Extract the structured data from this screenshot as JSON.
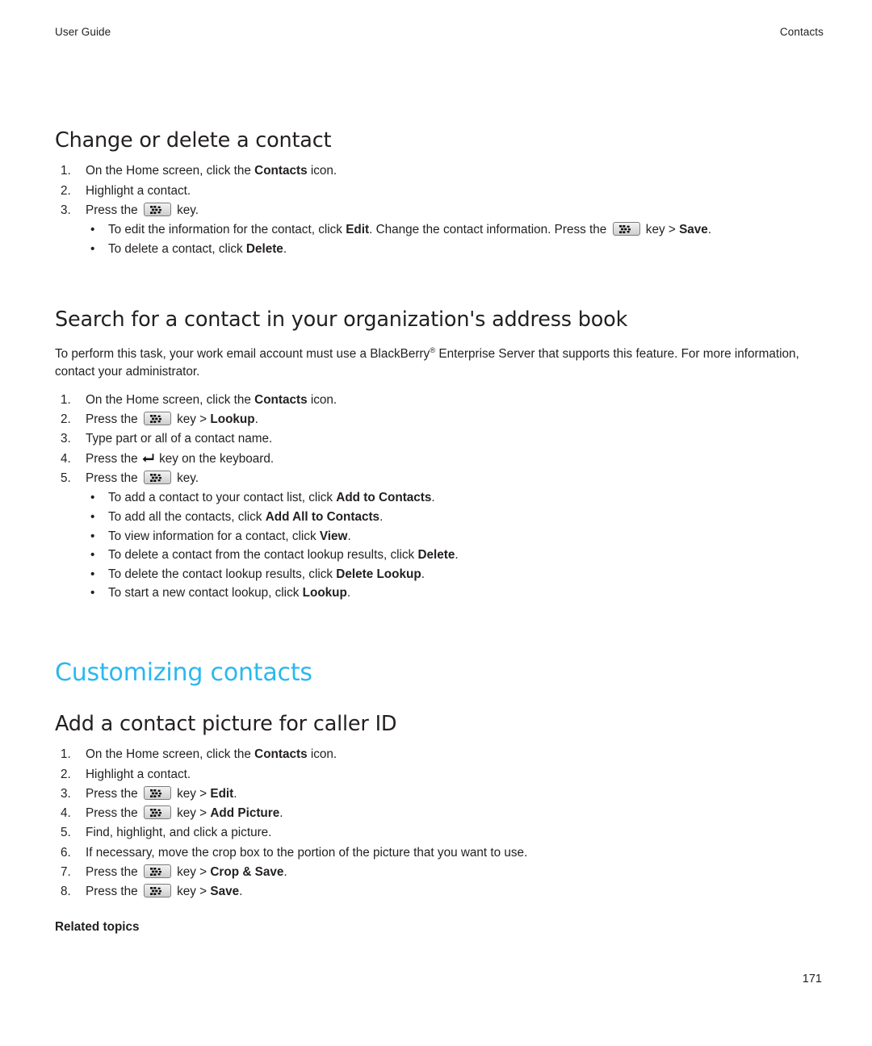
{
  "header": {
    "left": "User Guide",
    "right": "Contacts"
  },
  "icons": {
    "menu_key": "blackberry-menu-key-icon",
    "enter_key": "enter-return-key-icon"
  },
  "colors": {
    "chapter_heading": "#2bb8ef",
    "body_text": "#231f20",
    "key_glyph_border": "#7b7b7b",
    "key_glyph_fill": "#dedede"
  },
  "sections": {
    "change_delete": {
      "heading": "Change or delete a contact",
      "steps": [
        {
          "num": "1.",
          "parts": [
            {
              "t": "On the Home screen, click the "
            },
            {
              "t": "Contacts",
              "b": true
            },
            {
              "t": " icon."
            }
          ]
        },
        {
          "num": "2.",
          "parts": [
            {
              "t": "Highlight a contact."
            }
          ]
        },
        {
          "num": "3.",
          "parts": [
            {
              "t": "Press the "
            },
            {
              "key": "menu"
            },
            {
              "t": " key."
            }
          ],
          "bullets": [
            {
              "parts": [
                {
                  "t": "To edit the information for the contact, click "
                },
                {
                  "t": "Edit",
                  "b": true
                },
                {
                  "t": ". Change the contact information. Press the "
                },
                {
                  "key": "menu"
                },
                {
                  "t": " key > "
                },
                {
                  "t": "Save",
                  "b": true
                },
                {
                  "t": "."
                }
              ]
            },
            {
              "parts": [
                {
                  "t": "To delete a contact, click "
                },
                {
                  "t": "Delete",
                  "b": true
                },
                {
                  "t": "."
                }
              ]
            }
          ]
        }
      ]
    },
    "search_org": {
      "heading": "Search for a contact in your organization's address book",
      "intro": [
        {
          "t": "To perform this task, your work email account must use a BlackBerry"
        },
        {
          "sup": "®"
        },
        {
          "t": " Enterprise Server that supports this feature. For more information, contact your administrator."
        }
      ],
      "steps": [
        {
          "num": "1.",
          "parts": [
            {
              "t": "On the Home screen, click the "
            },
            {
              "t": "Contacts",
              "b": true
            },
            {
              "t": " icon."
            }
          ]
        },
        {
          "num": "2.",
          "parts": [
            {
              "t": "Press the "
            },
            {
              "key": "menu"
            },
            {
              "t": " key > "
            },
            {
              "t": "Lookup",
              "b": true
            },
            {
              "t": "."
            }
          ]
        },
        {
          "num": "3.",
          "parts": [
            {
              "t": "Type part or all of a contact name."
            }
          ]
        },
        {
          "num": "4.",
          "parts": [
            {
              "t": "Press the "
            },
            {
              "key": "enter"
            },
            {
              "t": " key on the keyboard."
            }
          ]
        },
        {
          "num": "5.",
          "parts": [
            {
              "t": "Press the "
            },
            {
              "key": "menu"
            },
            {
              "t": " key."
            }
          ],
          "bullets": [
            {
              "parts": [
                {
                  "t": "To add a contact to your contact list, click "
                },
                {
                  "t": "Add to Contacts",
                  "b": true
                },
                {
                  "t": "."
                }
              ]
            },
            {
              "parts": [
                {
                  "t": "To add all the contacts, click "
                },
                {
                  "t": "Add All to Contacts",
                  "b": true
                },
                {
                  "t": "."
                }
              ]
            },
            {
              "parts": [
                {
                  "t": "To view information for a contact, click "
                },
                {
                  "t": "View",
                  "b": true
                },
                {
                  "t": "."
                }
              ]
            },
            {
              "parts": [
                {
                  "t": "To delete a contact from the contact lookup results, click "
                },
                {
                  "t": "Delete",
                  "b": true
                },
                {
                  "t": "."
                }
              ]
            },
            {
              "parts": [
                {
                  "t": "To delete the contact lookup results, click "
                },
                {
                  "t": "Delete Lookup",
                  "b": true
                },
                {
                  "t": "."
                }
              ]
            },
            {
              "parts": [
                {
                  "t": "To start a new contact lookup, click "
                },
                {
                  "t": "Lookup",
                  "b": true
                },
                {
                  "t": "."
                }
              ]
            }
          ]
        }
      ]
    },
    "customizing": {
      "heading": "Customizing contacts"
    },
    "add_picture": {
      "heading": "Add a contact picture for caller ID",
      "steps": [
        {
          "num": "1.",
          "parts": [
            {
              "t": "On the Home screen, click the "
            },
            {
              "t": "Contacts",
              "b": true
            },
            {
              "t": " icon."
            }
          ]
        },
        {
          "num": "2.",
          "parts": [
            {
              "t": "Highlight a contact."
            }
          ]
        },
        {
          "num": "3.",
          "parts": [
            {
              "t": "Press the "
            },
            {
              "key": "menu"
            },
            {
              "t": " key > "
            },
            {
              "t": "Edit",
              "b": true
            },
            {
              "t": "."
            }
          ]
        },
        {
          "num": "4.",
          "parts": [
            {
              "t": "Press the "
            },
            {
              "key": "menu"
            },
            {
              "t": " key > "
            },
            {
              "t": "Add Picture",
              "b": true
            },
            {
              "t": "."
            }
          ]
        },
        {
          "num": "5.",
          "parts": [
            {
              "t": "Find, highlight, and click a picture."
            }
          ]
        },
        {
          "num": "6.",
          "parts": [
            {
              "t": "If necessary, move the crop box to the portion of the picture that you want to use."
            }
          ]
        },
        {
          "num": "7.",
          "parts": [
            {
              "t": "Press the "
            },
            {
              "key": "menu"
            },
            {
              "t": " key > "
            },
            {
              "t": "Crop & Save",
              "b": true
            },
            {
              "t": "."
            }
          ]
        },
        {
          "num": "8.",
          "parts": [
            {
              "t": "Press the "
            },
            {
              "key": "menu"
            },
            {
              "t": " key > "
            },
            {
              "t": "Save",
              "b": true
            },
            {
              "t": "."
            }
          ]
        }
      ],
      "related_topics_label": "Related topics"
    }
  },
  "footer": {
    "page_number": "171"
  }
}
